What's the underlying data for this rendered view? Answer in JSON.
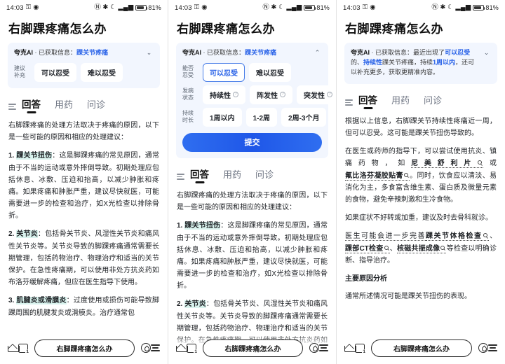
{
  "status_bar": {
    "time": "14:03",
    "battery_percent": "81%",
    "icons": [
      "key-icon",
      "eye-icon",
      "nfc-icon",
      "bluetooth-icon",
      "dnd-moon-icon",
      "signal-icon",
      "wifi-signal-icon",
      "battery-icon"
    ]
  },
  "page_title": "右脚踝疼痛怎么办",
  "info_card": {
    "brand": "夸克AI",
    "sep": "·",
    "prefix_p1": "已获取信息：",
    "keyword_p1": "踝关节疼痛",
    "suggest_label_line1": "建议",
    "suggest_label_line2": "补充",
    "chevron_down": "⌄",
    "chevron_up": "⌃",
    "p3_text_1": "已获取信息：最近出现了",
    "p3_hl_1": "可以忍受",
    "p3_text_2": "的、",
    "p3_hl_2": "持续性",
    "p3_text_3": "踝关节疼痛，持续",
    "p3_hl_3": "1周以内",
    "p3_text_4": "，还可以补充更多，获取更精准内容。"
  },
  "form": {
    "rows": [
      {
        "label_line1": "能否",
        "label_line2": "忍受",
        "options": [
          {
            "text": "可以忍受",
            "selected": true,
            "info": false
          },
          {
            "text": "难以忍受",
            "selected": false,
            "info": false
          }
        ]
      },
      {
        "label_line1": "发病",
        "label_line2": "状态",
        "options": [
          {
            "text": "持续性",
            "selected": false,
            "info": true
          },
          {
            "text": "阵发性",
            "selected": false,
            "info": true
          },
          {
            "text": "突发性",
            "selected": false,
            "info": true
          }
        ]
      },
      {
        "label_line1": "持续",
        "label_line2": "时长",
        "options": [
          {
            "text": "1周以内",
            "selected": false,
            "info": false
          },
          {
            "text": "1-2周",
            "selected": false,
            "info": false
          },
          {
            "text": "2周-3个月",
            "selected": false,
            "info": false
          }
        ]
      }
    ],
    "submit_label": "提交",
    "info_mark": "?"
  },
  "tabs": [
    {
      "label": "回答",
      "active": true
    },
    {
      "label": "用药",
      "active": false
    },
    {
      "label": "问诊",
      "active": false
    }
  ],
  "answer_a": {
    "intro": "右脚踝疼痛的处理方法取决于疼痛的原因，以下是一些可能的原因和相应的处理建议：",
    "items": [
      {
        "num": "1. ",
        "term": "踝关节扭伤",
        "body": "：这是脚踝疼痛的常见原因，通常由于不当的运动或意外摔倒导致。初期处理应包括休息、冰敷、压迫和抬高，以减少肿胀和疼痛。如果疼痛和肿胀严重，建议尽快就医，可能需要进一步的检查和治疗，如X光检查以排除骨折。"
      },
      {
        "num": "2. ",
        "term": "关节炎",
        "body": "：包括骨关节炎、风湿性关节炎和痛风性关节炎等。关节炎导致的脚踝疼痛通常需要长期管理，包括药物治疗、物理治疗和适当的关节保护。在急性疼痛期，可以使用非处方抗炎药如布洛芬缓解疼痛，但应在医生指导下使用。"
      },
      {
        "num": "3. ",
        "term": "肌腱炎或滑膜炎",
        "body": "：过度使用或损伤可能导致脚踝周围的肌腱发炎或滑膜炎。治疗通常包"
      }
    ]
  },
  "answer_c": {
    "p1": "根据以上信息，右脚踝关节持续性疼痛近一周，但可以忍受。这可能是踝关节扭伤导致的。",
    "p2_a": "在医生或药师的指导下，可以尝试使用抗炎、镇痛药物，如",
    "p2_drug1": "尼美舒利片",
    "p2_b": "或",
    "p2_drug2": "氟比洛芬凝胶贴膏",
    "p2_c": "。同时，饮食应以清淡、易消化为主，多食富含维生素、蛋白质及微量元素的食物，避免辛辣刺激和生冷食物。",
    "p3": "如果症状不好转或加重，建议及时去骨科就诊。",
    "p4_a": "医生可能会进一步完善",
    "p4_ex1": "踝关节体格检查",
    "p4_b": "、",
    "p4_ex2": "踝部CT检查",
    "p4_c": "、",
    "p4_ex3": "核磁共振成像",
    "p4_d": "等检查以明确诊断、指导治疗。",
    "heading": "主要原因分析",
    "p5": "通常所述情况可能是踝关节扭伤的表现。"
  },
  "bottom_nav": {
    "home_label": "home-icon",
    "tabs_label": "tabs-icon",
    "query": "右脚踝疼痛怎么办",
    "speaker_label": "speaker-icon",
    "menu_label": "menu-icon"
  },
  "colors": {
    "accent": "#2a63e8",
    "card_bg": "#f2f6fe",
    "highlight": "#d9f3ee"
  }
}
